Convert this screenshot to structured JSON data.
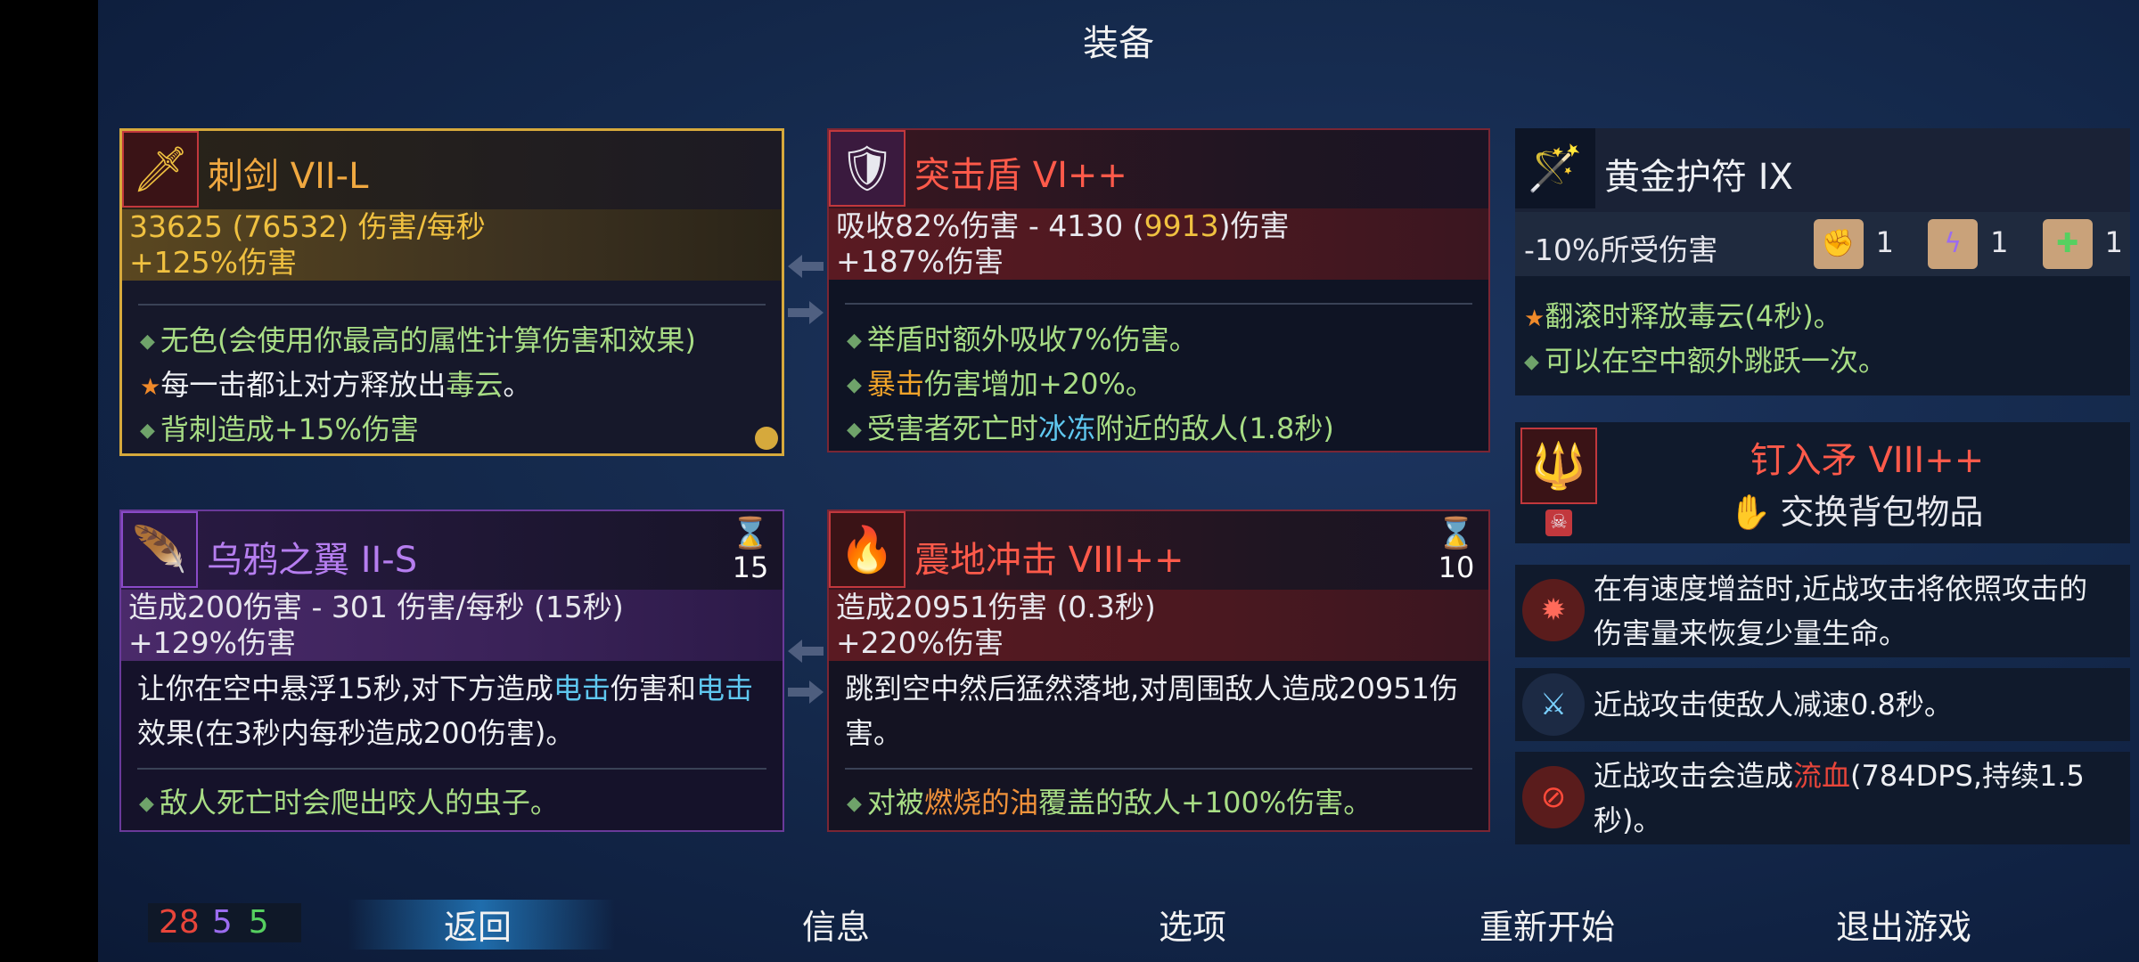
{
  "title": "装备",
  "cards": {
    "weapon1": {
      "name": "刺剑 VII-L",
      "dps_prefix": "33625 (",
      "dps_crit": "76532",
      "dps_suffix": ") 伤害/每秒",
      "bonus": "+125%伤害",
      "perk1": "无色(会使用你最高的属性计算伤害和效果)",
      "perk2_a": "每一击都让对方释放出",
      "perk2_b": "毒云",
      "perk2_c": "。",
      "perk3": "背刺造成+15%伤害"
    },
    "weapon2": {
      "name": "突击盾 VI++",
      "stat_a": "吸收82%伤害 - 4130 (",
      "stat_b": "9913",
      "stat_c": ")伤害",
      "bonus": "+187%伤害",
      "perk1": "举盾时额外吸收7%伤害。",
      "perk2_a": "暴击",
      "perk2_b": "伤害增加+20%。",
      "perk3_a": "受害者死亡时",
      "perk3_b": "冰冻",
      "perk3_c": "附近的敌人(1.8秒)"
    },
    "skill1": {
      "name": "乌鸦之翼 II-S",
      "timer": "15",
      "stat": "造成200伤害 - 301 伤害/每秒 (15秒)",
      "bonus": "+129%伤害",
      "desc_a": "让你在空中悬浮15秒,对下方造成",
      "desc_b": "电击",
      "desc_c": "伤害和",
      "desc_d": "电击",
      "desc_e": "效果(在3秒内每秒造成200伤害)。",
      "perk1": "敌人死亡时会爬出咬人的虫子。"
    },
    "skill2": {
      "name": "震地冲击 VIII++",
      "timer": "10",
      "stat": "造成20951伤害 (0.3秒)",
      "bonus": "+220%伤害",
      "desc": "跳到空中然后猛然落地,对周围敌人造成20951伤害。",
      "perk1_a": "对被",
      "perk1_b": "燃烧的油",
      "perk1_c": "覆盖的敌人+100%伤害。"
    }
  },
  "amulet": {
    "name": "黄金护符 IX",
    "stat": "-10%所受伤害",
    "scrolls": [
      "1",
      "1",
      "1"
    ],
    "perk1_a": "翻滚时释放",
    "perk1_b": "毒云",
    "perk1_c": "(4秒)。",
    "perk2": "可以在空中额外跳跃一次。"
  },
  "backpack": {
    "name": "钉入矛 VIII++",
    "swap_label": "交换背包物品"
  },
  "mutations": [
    {
      "icon": "bleeding-heart-icon",
      "text": "在有速度增益时,近战攻击将依照攻击的伤害量来恢复少量生命。"
    },
    {
      "icon": "slow-blade-icon",
      "text": "近战攻击使敌人减速0.8秒。"
    },
    {
      "icon_name": "blood-icon",
      "text_a": "近战攻击会造成",
      "text_b": "流血",
      "text_c": "(784DPS,持续1.5秒)。"
    }
  ],
  "scrolls_count": {
    "brutality": "28",
    "tactics": "5",
    "survival": "5"
  },
  "menu": {
    "back": "返回",
    "info": "信息",
    "options": "选项",
    "restart": "重新开始",
    "quit": "退出游戏"
  },
  "colors": {
    "brutality": "#e8453a",
    "tactics": "#9b6cf0",
    "survival": "#56d060"
  }
}
